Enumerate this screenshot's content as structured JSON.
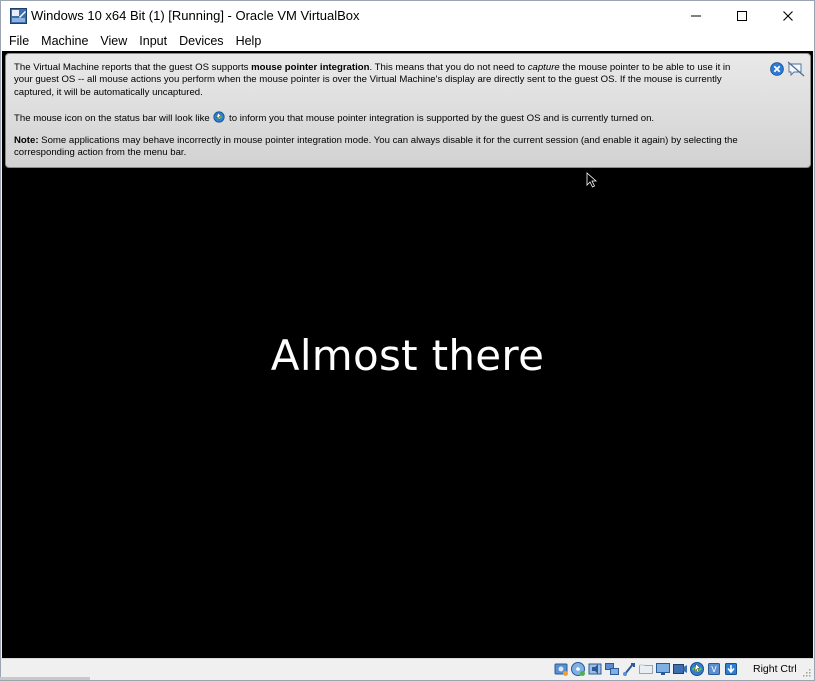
{
  "window": {
    "title": "Windows 10 x64 Bit (1) [Running] - Oracle VM VirtualBox",
    "icon": "virtualbox-icon"
  },
  "menu": [
    "File",
    "Machine",
    "View",
    "Input",
    "Devices",
    "Help"
  ],
  "notice": {
    "p1_a": "The Virtual Machine reports that the guest OS supports ",
    "p1_bold": "mouse pointer integration",
    "p1_b": ". This means that you do not need to ",
    "p1_italic": "capture",
    "p1_c": " the mouse pointer to be able to use it in your guest OS -- all mouse actions you perform when the mouse pointer is over the Virtual Machine's display are directly sent to the guest OS. If the mouse is currently captured, it will be automatically uncaptured.",
    "p2_a": "The mouse icon on the status bar will look like ",
    "p2_b": " to inform you that mouse pointer integration is supported by the guest OS and is currently turned on.",
    "p3_bold": "Note:",
    "p3_text": " Some applications may behave incorrectly in mouse pointer integration mode. You can always disable it for the current session (and enable it again) by selecting the corresponding action from the menu bar."
  },
  "screen": {
    "message": "Almost there"
  },
  "statusbar": {
    "host_key": "Right Ctrl",
    "icons": [
      "hard-disk-icon",
      "optical-drive-icon",
      "audio-icon",
      "network-icon",
      "usb-icon",
      "shared-folder-icon",
      "display-icon",
      "video-capture-icon",
      "mouse-integration-icon",
      "cpu-icon",
      "keyboard-icon"
    ]
  },
  "colors": {
    "accent": "#1e6fd9",
    "notice_bg": "#dddddd",
    "vm_bg": "#000000"
  }
}
